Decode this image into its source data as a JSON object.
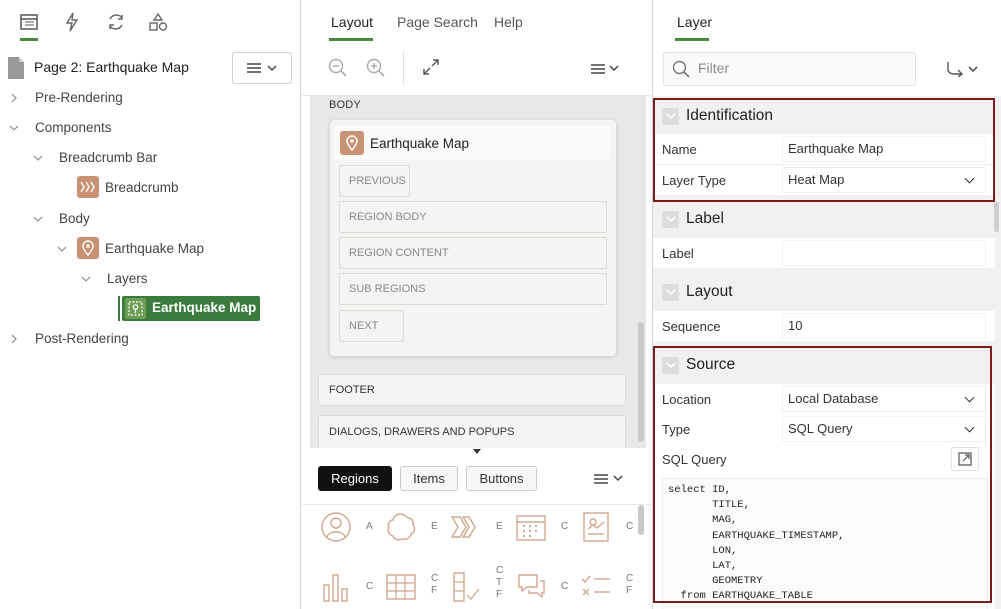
{
  "left": {
    "tabs": [
      "rendering-tab",
      "dynamic-actions-tab",
      "processing-tab",
      "shared-components-tab"
    ],
    "page_title": "Page 2: Earthquake Map",
    "tree": {
      "pre_rendering": "Pre-Rendering",
      "components": "Components",
      "breadcrumb_bar": "Breadcrumb Bar",
      "breadcrumb": "Breadcrumb",
      "body": "Body",
      "earthquake_map_region": "Earthquake Map",
      "layers": "Layers",
      "earthquake_map_layer": "Earthquake Map",
      "post_rendering": "Post-Rendering"
    }
  },
  "mid": {
    "tabs": {
      "layout": "Layout",
      "page_search": "Page Search",
      "help": "Help"
    },
    "gallery": {
      "body_label": "BODY",
      "region_title": "Earthquake Map",
      "slots": {
        "previous": "PREVIOUS",
        "region_body": "REGION BODY",
        "region_content": "REGION CONTENT",
        "sub_regions": "SUB REGIONS",
        "next": "NEXT"
      },
      "footer": "FOOTER",
      "dialogs": "DIALOGS, DRAWERS AND POPUPS"
    },
    "palette_tabs": {
      "regions": "Regions",
      "items": "Items",
      "buttons": "Buttons"
    },
    "palette_items": [
      {
        "icon": "user-icon",
        "label": "A"
      },
      {
        "icon": "cloud-icon",
        "label": "E"
      },
      {
        "icon": "breadcrumb-icon",
        "label": "E"
      },
      {
        "icon": "calendar-icon",
        "label": "C"
      },
      {
        "icon": "card-icon",
        "label": "C"
      },
      {
        "icon": "bar-chart-icon",
        "label": "C"
      },
      {
        "icon": "grid-icon",
        "label": "C\nF"
      },
      {
        "icon": "checklist-icon",
        "label": "C\nT\nF"
      },
      {
        "icon": "chat-icon",
        "label": "C"
      },
      {
        "icon": "list-check-icon",
        "label": "C\nF"
      }
    ]
  },
  "right": {
    "tab": "Layer",
    "filter_placeholder": "Filter",
    "groups": {
      "identification": {
        "title": "Identification",
        "name_label": "Name",
        "name_value": "Earthquake Map",
        "type_label": "Layer Type",
        "type_value": "Heat Map"
      },
      "label": {
        "title": "Label",
        "label_label": "Label",
        "label_value": ""
      },
      "layout": {
        "title": "Layout",
        "sequence_label": "Sequence",
        "sequence_value": "10"
      },
      "source": {
        "title": "Source",
        "location_label": "Location",
        "location_value": "Local Database",
        "type_label": "Type",
        "type_value": "SQL Query",
        "sql_label": "SQL Query",
        "sql": "select ID,\n       TITLE,\n       MAG,\n       EARTHQUAKE_TIMESTAMP,\n       LON,\n       LAT,\n       GEOMETRY\n  from EARTHQUAKE_TABLE"
      }
    }
  },
  "colors": {
    "accent_green": "#4a8a3c",
    "highlight_red": "#7a1b1e",
    "node_tan": "#c99275"
  }
}
